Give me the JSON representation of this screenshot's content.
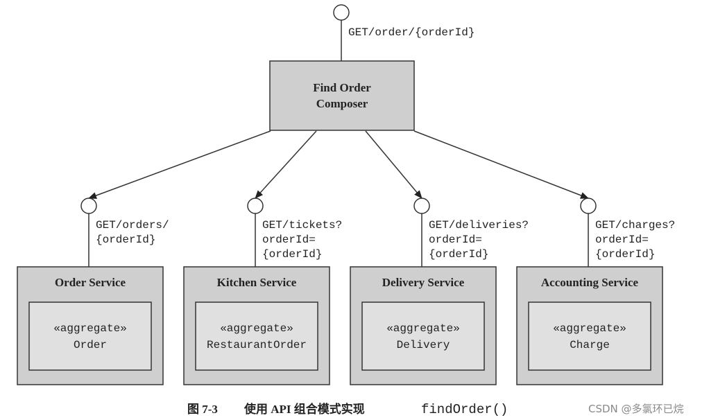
{
  "composer": {
    "endpoint": "GET/order/{orderId}",
    "title_line1": "Find Order",
    "title_line2": "Composer"
  },
  "services": [
    {
      "name": "Order Service",
      "endpoint": [
        "GET/orders/",
        "{orderId}",
        ""
      ],
      "stereotype": "«aggregate»",
      "aggregate": "Order"
    },
    {
      "name": "Kitchen Service",
      "endpoint": [
        "GET/tickets?",
        "orderId=",
        "{orderId}"
      ],
      "stereotype": "«aggregate»",
      "aggregate": "RestaurantOrder"
    },
    {
      "name": "Delivery Service",
      "endpoint": [
        "GET/deliveries?",
        "orderId=",
        "{orderId}"
      ],
      "stereotype": "«aggregate»",
      "aggregate": "Delivery"
    },
    {
      "name": "Accounting Service",
      "endpoint": [
        "GET/charges?",
        "orderId=",
        "{orderId}"
      ],
      "stereotype": "«aggregate»",
      "aggregate": "Charge"
    }
  ],
  "caption": {
    "label": "图 7-3",
    "text": "使用 API 组合模式实现",
    "code": "findOrder()"
  },
  "watermark": "CSDN @多氯环已烷"
}
